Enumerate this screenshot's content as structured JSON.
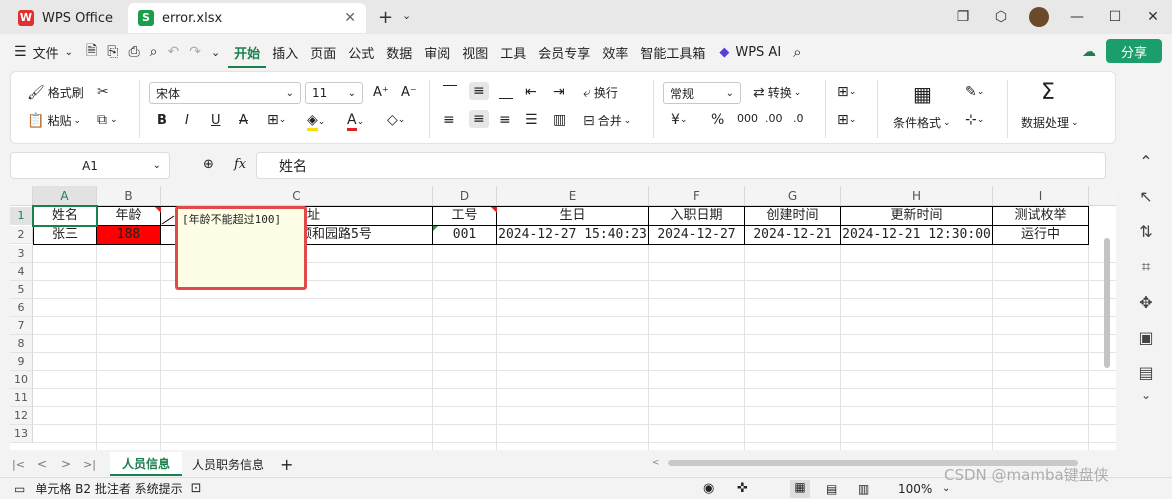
{
  "tabs": [
    {
      "label": "WPS Office"
    },
    {
      "label": "error.xlsx"
    }
  ],
  "menu": [
    "文件",
    "开始",
    "插入",
    "页面",
    "公式",
    "数据",
    "审阅",
    "视图",
    "工具",
    "会员专享",
    "效率",
    "智能工具箱",
    "WPS AI"
  ],
  "share_label": "分享",
  "ribbon": {
    "format_painter": "格式刷",
    "paste": "粘贴",
    "font_name": "宋体",
    "font_size": "11",
    "wrap": "换行",
    "merge": "合并",
    "number_format": "常规",
    "convert": "转换",
    "conditional_format": "条件格式",
    "data_processing": "数据处理"
  },
  "formula": {
    "cell_ref": "A1",
    "fx": "fx",
    "value": "姓名"
  },
  "columns": [
    "A",
    "B",
    "C",
    "D",
    "E",
    "F",
    "G",
    "H",
    "I"
  ],
  "rows": [
    "1",
    "2",
    "3",
    "4",
    "5",
    "6",
    "7",
    "8",
    "9",
    "10",
    "11",
    "12",
    "13"
  ],
  "row1": [
    "姓名",
    "年龄",
    "址",
    "工号",
    "生日",
    "入职日期",
    "创建时间",
    "更新时间",
    "测试枚举"
  ],
  "row2": [
    "张三",
    "188",
    "颐和园路5号",
    "001",
    "2024-12-27 15:40:23",
    "2024-12-27",
    "2024-12-21",
    "2024-12-21 12:30:00",
    "运行中"
  ],
  "comment": "[年龄不能超过100]",
  "sheet_tabs": [
    "人员信息",
    "人员职务信息"
  ],
  "status": {
    "text": "单元格 B2 批注者 系统提示",
    "zoom": "100%"
  },
  "watermark": "CSDN @mamba键盘侠",
  "colors": {
    "accent": "#1b7f4e",
    "error_fill": "#ff0000"
  }
}
